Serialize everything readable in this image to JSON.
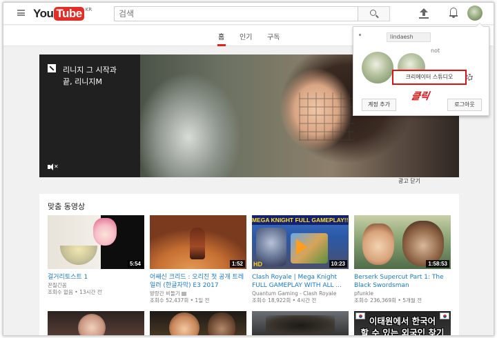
{
  "header": {
    "logo_you": "You",
    "logo_tube": "Tube",
    "logo_region": "KR",
    "search_placeholder": "검색"
  },
  "tabs": [
    {
      "label": "홈",
      "active": true
    },
    {
      "label": "인기",
      "active": false
    },
    {
      "label": "구독",
      "active": false
    }
  ],
  "hero": {
    "text_line1": "리니지 그 시작과",
    "text_line2": "끝, 리니지M",
    "ad_close_label": "광고 닫기"
  },
  "section": {
    "title": "맞춤 동영상",
    "videos": [
      {
        "title": "걸거리토스트 1",
        "channel": "꼰질긴꼼",
        "meta": "조회수 없음 • 13시간 전",
        "duration": "5:54"
      },
      {
        "title": "어쌔신 크리드 : 오리진 첫 공개 트레일러 (한글자막) E3 2017",
        "channel": "방랑간 비들기",
        "meta": "조회수 52,437회 • 1일 전",
        "duration": "1:52",
        "verified": true
      },
      {
        "title": "Clash Royale | Mega Knight FULL GAMEPLAY WITH ALL ...",
        "channel": "Quantum Gaming - Clash Royale",
        "meta": "조회수 18,922회 • 4시간 전",
        "duration": "10:23",
        "banner": "MEGA KNIGHT FULL GAMEPLAY!!!",
        "hd": "HD"
      },
      {
        "title": "Berserk Supercut Part 1: The Black Swordsman",
        "channel": "pfunkle",
        "meta": "조회수 236,369회 • 5개월 전",
        "duration": "1:58:53"
      }
    ],
    "row2_caption_line1": "이태원에서 한국어",
    "row2_caption_line2": "할 수 있는 외국인 찾기"
  },
  "popup": {
    "partial_name": "lindaesh",
    "email_partial": "not",
    "studio_button": "크리에이터 스튜디오",
    "click_label": "클릭",
    "add_account": "계정 추가",
    "logout": "로그아웃",
    "highlight_color": "#e10f0f"
  },
  "colors": {
    "brand_red": "#e52d27",
    "link_blue": "#167ac6",
    "tab_underline": "#e62117"
  }
}
